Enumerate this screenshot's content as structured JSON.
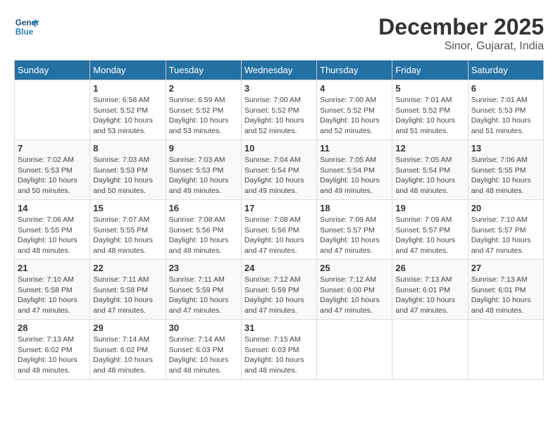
{
  "header": {
    "logo_line1": "General",
    "logo_line2": "Blue",
    "month": "December 2025",
    "location": "Sinor, Gujarat, India"
  },
  "weekdays": [
    "Sunday",
    "Monday",
    "Tuesday",
    "Wednesday",
    "Thursday",
    "Friday",
    "Saturday"
  ],
  "weeks": [
    [
      {
        "day": "",
        "info": ""
      },
      {
        "day": "1",
        "info": "Sunrise: 6:58 AM\nSunset: 5:52 PM\nDaylight: 10 hours\nand 53 minutes."
      },
      {
        "day": "2",
        "info": "Sunrise: 6:59 AM\nSunset: 5:52 PM\nDaylight: 10 hours\nand 53 minutes."
      },
      {
        "day": "3",
        "info": "Sunrise: 7:00 AM\nSunset: 5:52 PM\nDaylight: 10 hours\nand 52 minutes."
      },
      {
        "day": "4",
        "info": "Sunrise: 7:00 AM\nSunset: 5:52 PM\nDaylight: 10 hours\nand 52 minutes."
      },
      {
        "day": "5",
        "info": "Sunrise: 7:01 AM\nSunset: 5:52 PM\nDaylight: 10 hours\nand 51 minutes."
      },
      {
        "day": "6",
        "info": "Sunrise: 7:01 AM\nSunset: 5:53 PM\nDaylight: 10 hours\nand 51 minutes."
      }
    ],
    [
      {
        "day": "7",
        "info": "Sunrise: 7:02 AM\nSunset: 5:53 PM\nDaylight: 10 hours\nand 50 minutes."
      },
      {
        "day": "8",
        "info": "Sunrise: 7:03 AM\nSunset: 5:53 PM\nDaylight: 10 hours\nand 50 minutes."
      },
      {
        "day": "9",
        "info": "Sunrise: 7:03 AM\nSunset: 5:53 PM\nDaylight: 10 hours\nand 49 minutes."
      },
      {
        "day": "10",
        "info": "Sunrise: 7:04 AM\nSunset: 5:54 PM\nDaylight: 10 hours\nand 49 minutes."
      },
      {
        "day": "11",
        "info": "Sunrise: 7:05 AM\nSunset: 5:54 PM\nDaylight: 10 hours\nand 49 minutes."
      },
      {
        "day": "12",
        "info": "Sunrise: 7:05 AM\nSunset: 5:54 PM\nDaylight: 10 hours\nand 48 minutes."
      },
      {
        "day": "13",
        "info": "Sunrise: 7:06 AM\nSunset: 5:55 PM\nDaylight: 10 hours\nand 48 minutes."
      }
    ],
    [
      {
        "day": "14",
        "info": "Sunrise: 7:06 AM\nSunset: 5:55 PM\nDaylight: 10 hours\nand 48 minutes."
      },
      {
        "day": "15",
        "info": "Sunrise: 7:07 AM\nSunset: 5:55 PM\nDaylight: 10 hours\nand 48 minutes."
      },
      {
        "day": "16",
        "info": "Sunrise: 7:08 AM\nSunset: 5:56 PM\nDaylight: 10 hours\nand 48 minutes."
      },
      {
        "day": "17",
        "info": "Sunrise: 7:08 AM\nSunset: 5:56 PM\nDaylight: 10 hours\nand 47 minutes."
      },
      {
        "day": "18",
        "info": "Sunrise: 7:09 AM\nSunset: 5:57 PM\nDaylight: 10 hours\nand 47 minutes."
      },
      {
        "day": "19",
        "info": "Sunrise: 7:09 AM\nSunset: 5:57 PM\nDaylight: 10 hours\nand 47 minutes."
      },
      {
        "day": "20",
        "info": "Sunrise: 7:10 AM\nSunset: 5:57 PM\nDaylight: 10 hours\nand 47 minutes."
      }
    ],
    [
      {
        "day": "21",
        "info": "Sunrise: 7:10 AM\nSunset: 5:58 PM\nDaylight: 10 hours\nand 47 minutes."
      },
      {
        "day": "22",
        "info": "Sunrise: 7:11 AM\nSunset: 5:58 PM\nDaylight: 10 hours\nand 47 minutes."
      },
      {
        "day": "23",
        "info": "Sunrise: 7:11 AM\nSunset: 5:59 PM\nDaylight: 10 hours\nand 47 minutes."
      },
      {
        "day": "24",
        "info": "Sunrise: 7:12 AM\nSunset: 5:59 PM\nDaylight: 10 hours\nand 47 minutes."
      },
      {
        "day": "25",
        "info": "Sunrise: 7:12 AM\nSunset: 6:00 PM\nDaylight: 10 hours\nand 47 minutes."
      },
      {
        "day": "26",
        "info": "Sunrise: 7:13 AM\nSunset: 6:01 PM\nDaylight: 10 hours\nand 47 minutes."
      },
      {
        "day": "27",
        "info": "Sunrise: 7:13 AM\nSunset: 6:01 PM\nDaylight: 10 hours\nand 48 minutes."
      }
    ],
    [
      {
        "day": "28",
        "info": "Sunrise: 7:13 AM\nSunset: 6:02 PM\nDaylight: 10 hours\nand 48 minutes."
      },
      {
        "day": "29",
        "info": "Sunrise: 7:14 AM\nSunset: 6:02 PM\nDaylight: 10 hours\nand 48 minutes."
      },
      {
        "day": "30",
        "info": "Sunrise: 7:14 AM\nSunset: 6:03 PM\nDaylight: 10 hours\nand 48 minutes."
      },
      {
        "day": "31",
        "info": "Sunrise: 7:15 AM\nSunset: 6:03 PM\nDaylight: 10 hours\nand 48 minutes."
      },
      {
        "day": "",
        "info": ""
      },
      {
        "day": "",
        "info": ""
      },
      {
        "day": "",
        "info": ""
      }
    ]
  ]
}
